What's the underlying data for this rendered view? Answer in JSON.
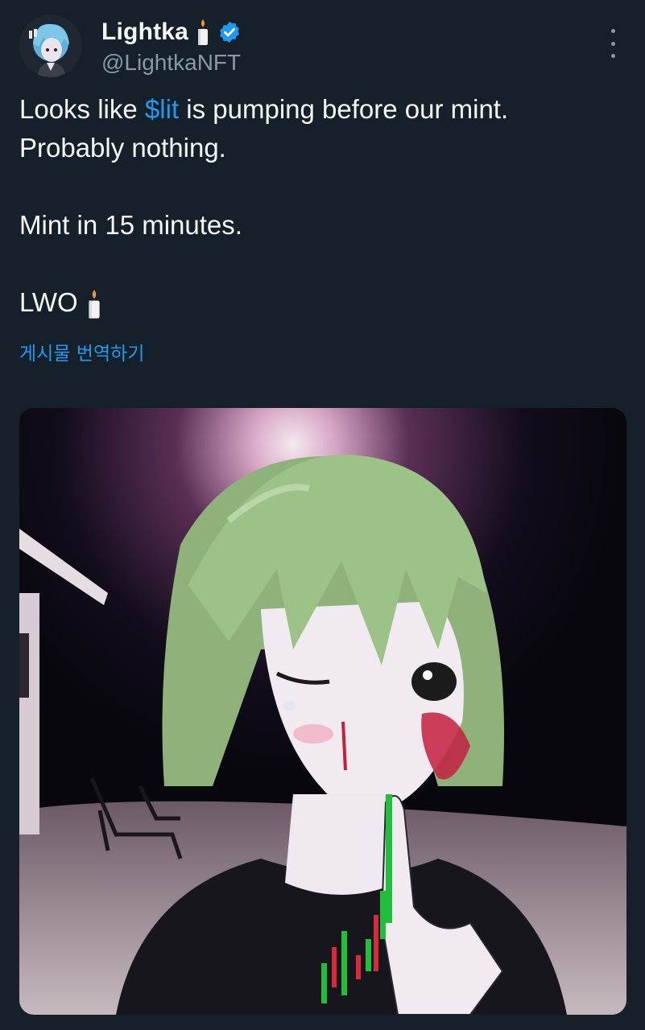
{
  "author": {
    "display_name": "Lightka",
    "name_emoji": "candle-icon",
    "verified": true,
    "handle": "@LightkaNFT",
    "avatar_icon": "avatar-anime-character"
  },
  "tweet": {
    "line1_prefix": "Looks like ",
    "cashtag": "$lit",
    "line1_suffix": " is pumping before our mint.",
    "line2": "Probably nothing.",
    "line3": "Mint in 15 minutes.",
    "line4": "LWO",
    "line4_emoji": "candle-icon",
    "translate_label": "게시물 번역하기"
  },
  "media": {
    "icon": "anime-girl-illustration-with-candlestick-chart"
  },
  "colors": {
    "background": "#15202b",
    "text": "#f7f9f9",
    "secondary": "#8b98a5",
    "accent": "#1d9bf0"
  }
}
